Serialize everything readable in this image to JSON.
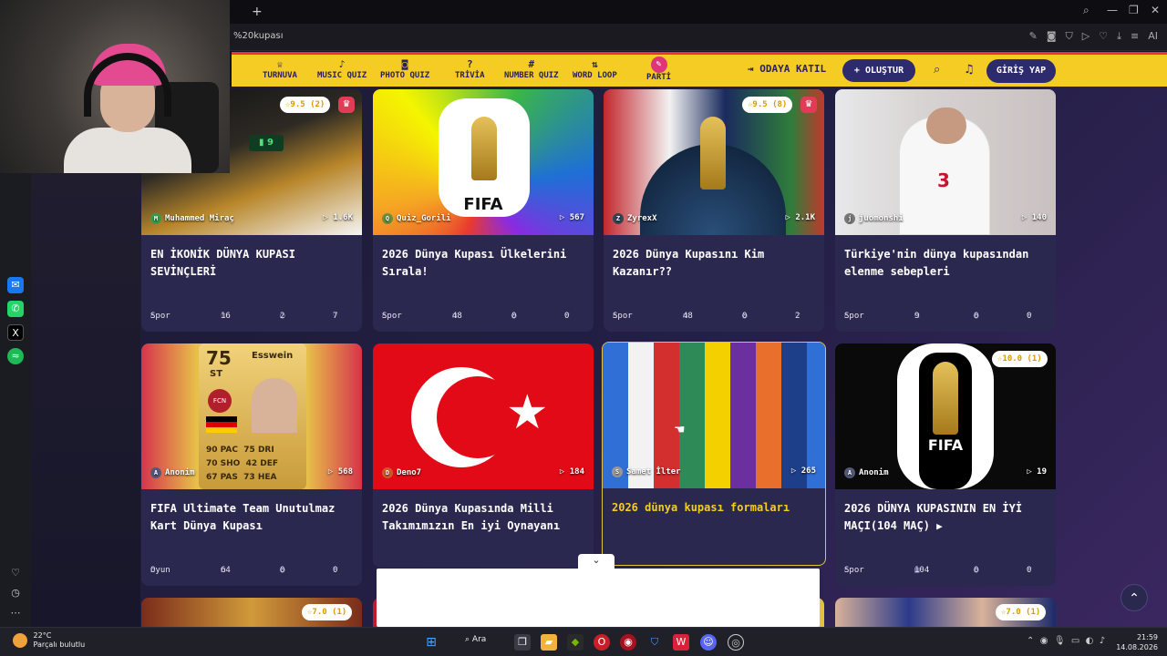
{
  "browser": {
    "address": "%20kupası",
    "new_tab": "+",
    "ai_label": "AI"
  },
  "nav": [
    {
      "icon": "♕",
      "label": "TURNUVA"
    },
    {
      "icon": "♪",
      "label": "MUSIC QUIZ"
    },
    {
      "icon": "◙",
      "label": "PHOTO QUIZ"
    },
    {
      "icon": "?",
      "label": "TRİVİA"
    },
    {
      "icon": "#",
      "label": "NUMBER QUIZ"
    },
    {
      "icon": "⇅",
      "label": "WORD LOOP"
    },
    {
      "icon": "✎",
      "label": "PARTİ"
    }
  ],
  "header": {
    "join": "ODAYA KATIL",
    "create": "+ OLUŞTUR",
    "login": "GİRİŞ YAP"
  },
  "cards": [
    {
      "author": "Muhammed Miraç",
      "av": "M",
      "plays": "1.6K",
      "rating": "9.5 (2)",
      "crown": true,
      "title": "EN İKONİK DÜNYA KUPASI SEVİNÇLERİ",
      "cat": "Spor",
      "items": "16",
      "comments": "2",
      "likes": "7",
      "overlay": "9"
    },
    {
      "author": "Quiz_Gorili",
      "av": "Q",
      "plays": "567",
      "rating": "",
      "crown": false,
      "title": "2026 Dünya Kupası Ülkelerini Sırala!",
      "cat": "Spor",
      "items": "48",
      "comments": "0",
      "likes": "0",
      "fifa": "FIFA"
    },
    {
      "author": "ZyrexX",
      "av": "Z",
      "plays": "2.1K",
      "rating": "9.5 (8)",
      "crown": true,
      "title": "2026 Dünya Kupasını Kim Kazanır??",
      "cat": "Spor",
      "items": "48",
      "comments": "0",
      "likes": "2"
    },
    {
      "author": "juomonshi",
      "av": "j",
      "plays": "140",
      "rating": "",
      "crown": false,
      "title": "Türkiye'nin dünya kupasından elenme sebepleri",
      "cat": "Spor",
      "items": "9",
      "comments": "0",
      "likes": "0"
    },
    {
      "author": "Anonim",
      "av": "A",
      "plays": "568",
      "rating": "",
      "crown": false,
      "title": "FIFA Ultimate Team Unutulmaz Kart Dünya Kupası",
      "cat": "Oyun",
      "items": "64",
      "comments": "0",
      "likes": "0",
      "fut": {
        "rating": "75",
        "pos": "ST",
        "name": "Esswein",
        "club": "FCN",
        "stats": [
          "90 PAC",
          "75 DRI",
          "70 SHO",
          "42 DEF",
          "67 PAS",
          "73 HEA"
        ]
      }
    },
    {
      "author": "Deno7",
      "av": "D",
      "plays": "184",
      "rating": "",
      "crown": false,
      "title": "2026 Dünya Kupasında Milli Takımımızın En iyi Oynayanı",
      "cat": "",
      "items": "",
      "comments": "",
      "likes": ""
    },
    {
      "author": "Samet İlter",
      "av": "S",
      "plays": "265",
      "rating": "",
      "crown": false,
      "title": "2026 dünya kupası formaları",
      "cat": "",
      "items": "",
      "comments": "",
      "likes": ""
    },
    {
      "author": "Anonim",
      "av": "A",
      "plays": "19",
      "rating": "10.0 (1)",
      "crown": false,
      "title": "2026 DÜNYA KUPASININ EN İYİ MAÇI(104 MAÇ)",
      "cat": "Spor",
      "items": "104",
      "comments": "0",
      "likes": "0",
      "fifa": "FIFA"
    }
  ],
  "partial_row": [
    {
      "rating": "7.0 (1)"
    },
    {
      "rating": "7.0 (1)"
    }
  ],
  "taskbar": {
    "temp": "22°C",
    "weather": "Parçalı bulutlu",
    "search": "Ara",
    "time": "21:59",
    "date": "14.08.2026"
  }
}
